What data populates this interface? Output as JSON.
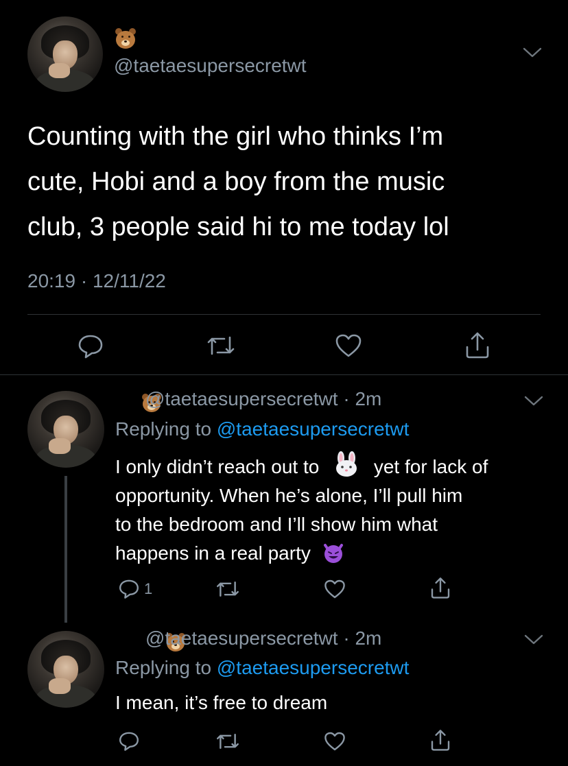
{
  "main_tweet": {
    "handle": "@taetaesupersecretwt",
    "text_line1": "Counting with the girl who thinks I’m",
    "text_line2": "cute, Hobi and a boy from the music",
    "text_line3": "club, 3 people said hi to me today lol",
    "timestamp": "20:19 · 12/11/22",
    "avatar_icon": "avatar-photo",
    "name_emoji": "bear-emoji"
  },
  "action_icons": [
    "reply-icon",
    "retweet-icon",
    "like-icon",
    "share-icon"
  ],
  "replies": [
    {
      "handle": "@taetaesupersecretwt",
      "time": "2m",
      "replying_prefix": "Replying to",
      "replying_handle": "@taetaesupersecretwt",
      "line1_a": "I only didn’t reach out to",
      "line1_b": "yet for lack of",
      "line2": "opportunity. When he’s alone, I’ll pull him",
      "line3": "to the bedroom and I’ll show him what",
      "line4": "happens in a real party",
      "inline_emoji_1": "rabbit-face-emoji",
      "inline_emoji_2": "smiling-devil-emoji",
      "reply_count": "1"
    },
    {
      "handle": "@taetaesupersecretwt",
      "time": "2m",
      "replying_prefix": "Replying to",
      "replying_handle": "@taetaesupersecretwt",
      "line1": "I mean, it’s free to dream"
    }
  ],
  "colors": {
    "background": "#000000",
    "text": "#ffffff",
    "muted": "#8b98a5",
    "link": "#1d9bf0",
    "divider": "#2f3336"
  }
}
